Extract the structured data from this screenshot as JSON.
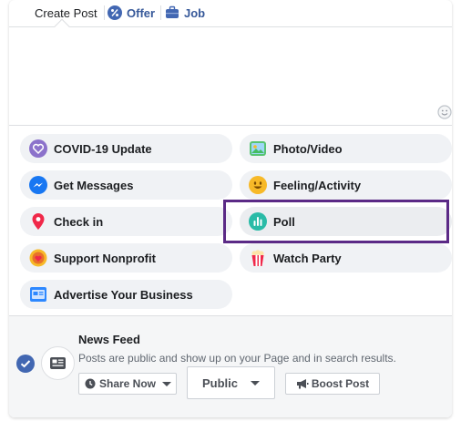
{
  "tabs": {
    "create_post": "Create Post",
    "offer": "Offer",
    "job": "Job"
  },
  "options": [
    {
      "label": "COVID-19 Update",
      "icon": "covid-heart-icon"
    },
    {
      "label": "Photo/Video",
      "icon": "photo-icon"
    },
    {
      "label": "Get Messages",
      "icon": "messenger-icon"
    },
    {
      "label": "Feeling/Activity",
      "icon": "smiley-icon"
    },
    {
      "label": "Check in",
      "icon": "location-pin-icon"
    },
    {
      "label": "Poll",
      "icon": "poll-icon"
    },
    {
      "label": "Support Nonprofit",
      "icon": "nonprofit-icon"
    },
    {
      "label": "Watch Party",
      "icon": "popcorn-icon"
    },
    {
      "label": "Advertise Your Business",
      "icon": "advertise-icon"
    }
  ],
  "footer": {
    "title": "News Feed",
    "description": "Posts are public and show up on your Page and in search results.",
    "share_label": "Share Now",
    "public_label": "Public",
    "boost_label": "Boost Post"
  },
  "colors": {
    "link": "#365899",
    "highlight": "#5b2a86",
    "pill_bg": "#f0f2f5",
    "footer_bg": "#f5f6f7",
    "check": "#4267b2"
  }
}
